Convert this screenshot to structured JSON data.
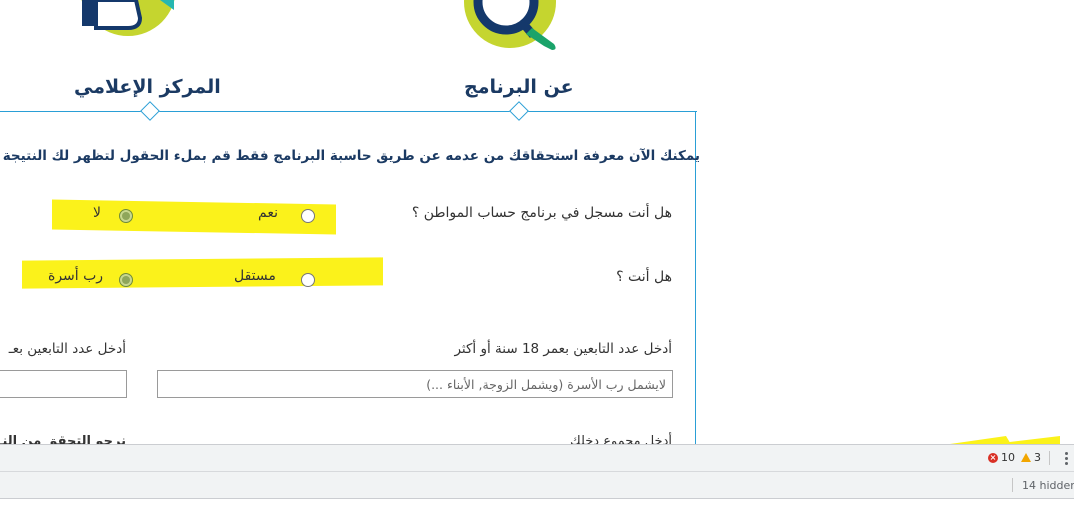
{
  "nav": {
    "media_center": "المركز الإعلامي",
    "about_program": "عن البرنامج"
  },
  "form": {
    "intro": "يمكنك الآن معرفة استحقاقك من عدمه عن طريق حاسبة البرنامج فقط قم بملء الحقول لتظهر لك النتيجة",
    "q_registered": {
      "label": "هل أنت مسجل في برنامج حساب المواطن ؟",
      "options": [
        "نعم",
        "لا"
      ],
      "selected": "لا"
    },
    "q_type": {
      "label": "هل أنت ؟",
      "options": [
        "مستقل",
        "رب أسرة"
      ],
      "selected": "رب أسرة"
    },
    "dependents_18plus": {
      "label": "أدخل عدد التابعين بعمر 18 سنة أو أكثر",
      "placeholder": "لايشمل رب الأسرة (ويشمل الزوجة, الأبناء ...)"
    },
    "dependents_under": {
      "label": "أدخل عدد التابعين بعـ"
    },
    "income_label_cut": "أدخل مجموع دخلك",
    "verify_label_cut": "نرجو التحقق من النـ"
  },
  "devtools": {
    "errors": "10",
    "warnings": "3",
    "hidden": "14 hidden"
  },
  "colors": {
    "accent_blue": "#2a9fd6",
    "navy": "#1b3a63",
    "lime": "#c5d52f",
    "green": "#1aa36a",
    "highlight": "#fbf21b"
  }
}
